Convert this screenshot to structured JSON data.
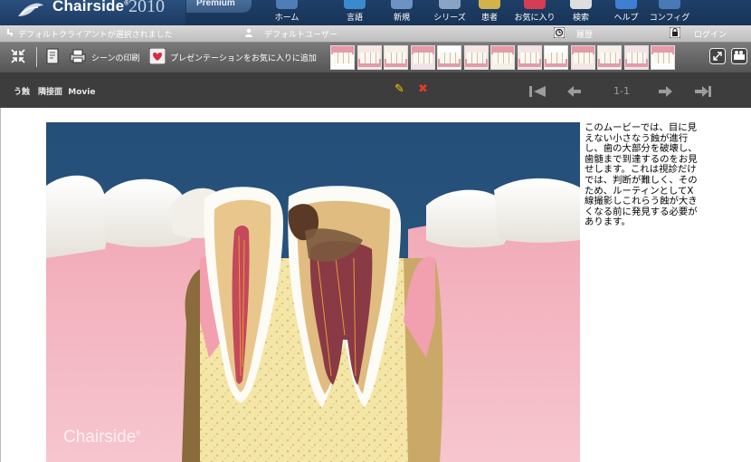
{
  "app": {
    "brand": "Chairside",
    "trademark": "®",
    "year": "2010",
    "edition": "Premium"
  },
  "nav": [
    {
      "label": "ホーム",
      "icon": "home-icon",
      "color": "#4f7db5"
    },
    {
      "label": "言語",
      "icon": "language-icon",
      "color": "#3a8ad0"
    },
    {
      "label": "新規",
      "icon": "new-icon",
      "color": "#6d93c4"
    },
    {
      "label": "シリーズ",
      "icon": "series-icon",
      "color": "#8aa3c4"
    },
    {
      "label": "患者",
      "icon": "patient-icon",
      "color": "#d1b24b"
    },
    {
      "label": "お気に入り",
      "icon": "favorites-icon",
      "color": "#d63c54"
    },
    {
      "label": "検索",
      "icon": "search-icon",
      "color": "#dedede"
    },
    {
      "label": "ヘルプ",
      "icon": "help-icon",
      "color": "#3f7fd3"
    },
    {
      "label": "コンフィグ",
      "icon": "config-icon",
      "color": "#4a79b8"
    }
  ],
  "status": {
    "client": "デフォルトクライアントが選択されました",
    "user": "デフォルトユーザー",
    "history": "履歴",
    "login": "ログイン"
  },
  "toolbar": {
    "print_scene": "シーンの印刷",
    "add_favorite": "プレゼンテーションをお気に入りに追加",
    "thumbnail_count": 13
  },
  "title_bar": {
    "title": "う蝕　隣接面",
    "type": "Movie",
    "page": "1-1"
  },
  "scene": {
    "watermark": "Chairside",
    "watermark_mark": "®"
  },
  "description": "このムービーでは、目に見えない小さなう蝕が進行し、歯の大部分を破壊し、歯髄まで到達するのをお見せします。これは視診だけでは、判断が難しく、そのため、ルーティンとしてX線撮影しこれらう蝕が大きくなる前に発見する必要があります。"
}
